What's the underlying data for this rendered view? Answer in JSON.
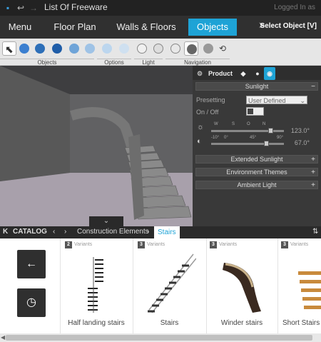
{
  "window": {
    "title": "List Of Freeware",
    "login": "Logged In as"
  },
  "menu": {
    "items": [
      {
        "label": "Menu"
      },
      {
        "label": "Floor Plan"
      },
      {
        "label": "Walls & Floors"
      },
      {
        "label": "Objects"
      }
    ],
    "select_object": "Select Object [V]"
  },
  "toolbar": {
    "groups": [
      {
        "label": "Objects"
      },
      {
        "label": "Options"
      },
      {
        "label": "Light"
      },
      {
        "label": "Navigation"
      }
    ]
  },
  "panel": {
    "tab_product": "Product",
    "sunlight": {
      "header": "Sunlight",
      "collapse": "−",
      "presetting_label": "Presetting",
      "presetting_value": "User Defined",
      "onoff_label": "On / Off",
      "compass_labels": [
        "W",
        "S",
        "O",
        "N"
      ],
      "altitude_labels": [
        "-10°",
        "0°",
        "45°",
        "90°"
      ],
      "azimuth_value": "123.0°",
      "altitude_value": "67.0°"
    },
    "sections": [
      {
        "label": "Extended Sunlight",
        "toggle": "+"
      },
      {
        "label": "Environment Themes",
        "toggle": "+"
      },
      {
        "label": "Ambient Light",
        "toggle": "+"
      }
    ]
  },
  "catalog": {
    "label": "CATALOG",
    "breadcrumb": "Construction Elements",
    "separator": "›",
    "active_tab": "Stairs",
    "items": [
      {
        "variants": "2",
        "variants_label": "Variants",
        "name": "Half landing stairs"
      },
      {
        "variants": "3",
        "variants_label": "Variants",
        "name": "Stairs"
      },
      {
        "variants": "3",
        "variants_label": "Variants",
        "name": "Winder stairs"
      },
      {
        "variants": "3",
        "variants_label": "Variants",
        "name": "Short Stairs"
      }
    ]
  },
  "colors": {
    "accent": "#1ea3d6",
    "dark_bg": "#2b2b2b",
    "toolbar_bg": "#e6e6e6"
  }
}
